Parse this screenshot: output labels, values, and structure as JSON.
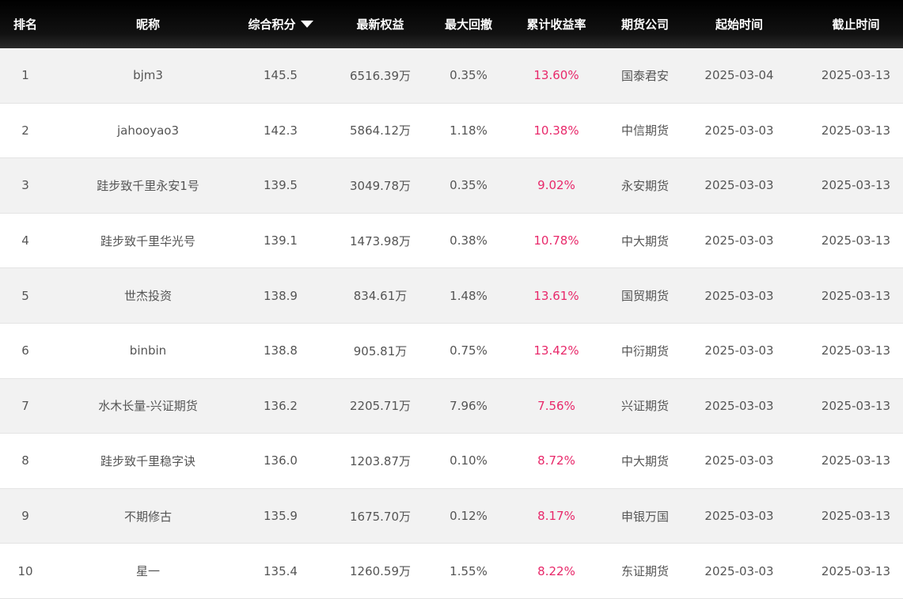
{
  "headers": [
    "排名",
    "昵称",
    "综合积分",
    "最新权益",
    "最大回撤",
    "累计收益率",
    "期货公司",
    "起始时间",
    "截止时间"
  ],
  "sort_icon": "sort-desc-icon",
  "colors": {
    "header_bg": "#000000",
    "rate_text": "#e8286a",
    "row_alt": "#f2f2f2"
  },
  "rows": [
    {
      "rank": "1",
      "name": "bjm3",
      "score": "145.5",
      "equity": "6516.39万",
      "drawdown": "0.35%",
      "rate": "13.60%",
      "company": "国泰君安",
      "start": "2025-03-04",
      "end": "2025-03-13"
    },
    {
      "rank": "2",
      "name": "jahooyao3",
      "score": "142.3",
      "equity": "5864.12万",
      "drawdown": "1.18%",
      "rate": "10.38%",
      "company": "中信期货",
      "start": "2025-03-03",
      "end": "2025-03-13"
    },
    {
      "rank": "3",
      "name": "跬步致千里永安1号",
      "score": "139.5",
      "equity": "3049.78万",
      "drawdown": "0.35%",
      "rate": "9.02%",
      "company": "永安期货",
      "start": "2025-03-03",
      "end": "2025-03-13"
    },
    {
      "rank": "4",
      "name": "跬步致千里华光号",
      "score": "139.1",
      "equity": "1473.98万",
      "drawdown": "0.38%",
      "rate": "10.78%",
      "company": "中大期货",
      "start": "2025-03-03",
      "end": "2025-03-13"
    },
    {
      "rank": "5",
      "name": "世杰投资",
      "score": "138.9",
      "equity": "834.61万",
      "drawdown": "1.48%",
      "rate": "13.61%",
      "company": "国贸期货",
      "start": "2025-03-03",
      "end": "2025-03-13"
    },
    {
      "rank": "6",
      "name": "binbin",
      "score": "138.8",
      "equity": "905.81万",
      "drawdown": "0.75%",
      "rate": "13.42%",
      "company": "中衍期货",
      "start": "2025-03-03",
      "end": "2025-03-13"
    },
    {
      "rank": "7",
      "name": "水木长量-兴证期货",
      "score": "136.2",
      "equity": "2205.71万",
      "drawdown": "7.96%",
      "rate": "7.56%",
      "company": "兴证期货",
      "start": "2025-03-03",
      "end": "2025-03-13"
    },
    {
      "rank": "8",
      "name": "跬步致千里稳字诀",
      "score": "136.0",
      "equity": "1203.87万",
      "drawdown": "0.10%",
      "rate": "8.72%",
      "company": "中大期货",
      "start": "2025-03-03",
      "end": "2025-03-13"
    },
    {
      "rank": "9",
      "name": "不期修古",
      "score": "135.9",
      "equity": "1675.70万",
      "drawdown": "0.12%",
      "rate": "8.17%",
      "company": "申银万国",
      "start": "2025-03-03",
      "end": "2025-03-13"
    },
    {
      "rank": "10",
      "name": "星一",
      "score": "135.4",
      "equity": "1260.59万",
      "drawdown": "1.55%",
      "rate": "8.22%",
      "company": "东证期货",
      "start": "2025-03-03",
      "end": "2025-03-13"
    }
  ]
}
